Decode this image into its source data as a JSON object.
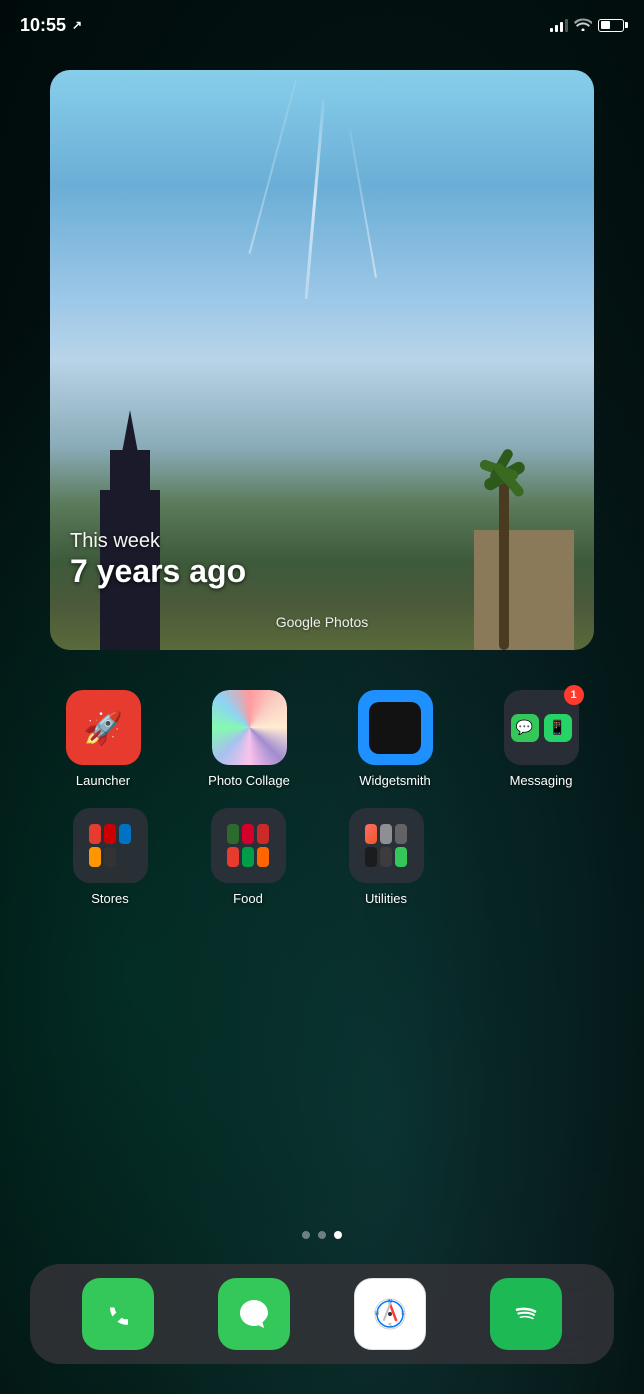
{
  "status_bar": {
    "time": "10:55",
    "location_arrow": "➤"
  },
  "widget": {
    "subtitle": "This week",
    "title": "7 years ago",
    "source": "Google Photos"
  },
  "app_row1": [
    {
      "id": "launcher",
      "label": "Launcher"
    },
    {
      "id": "photo-collage",
      "label": "Photo Collage"
    },
    {
      "id": "widgetsmith",
      "label": "Widgetsmith"
    },
    {
      "id": "messaging",
      "label": "Messaging",
      "badge": "1"
    }
  ],
  "app_row2": [
    {
      "id": "stores",
      "label": "Stores"
    },
    {
      "id": "food",
      "label": "Food"
    },
    {
      "id": "utilities",
      "label": "Utilities"
    }
  ],
  "page_dots": [
    {
      "active": false
    },
    {
      "active": false
    },
    {
      "active": true
    }
  ],
  "dock": [
    {
      "id": "phone",
      "label": "Phone"
    },
    {
      "id": "messages",
      "label": "Messages"
    },
    {
      "id": "safari",
      "label": "Safari"
    },
    {
      "id": "spotify",
      "label": "Spotify"
    }
  ]
}
